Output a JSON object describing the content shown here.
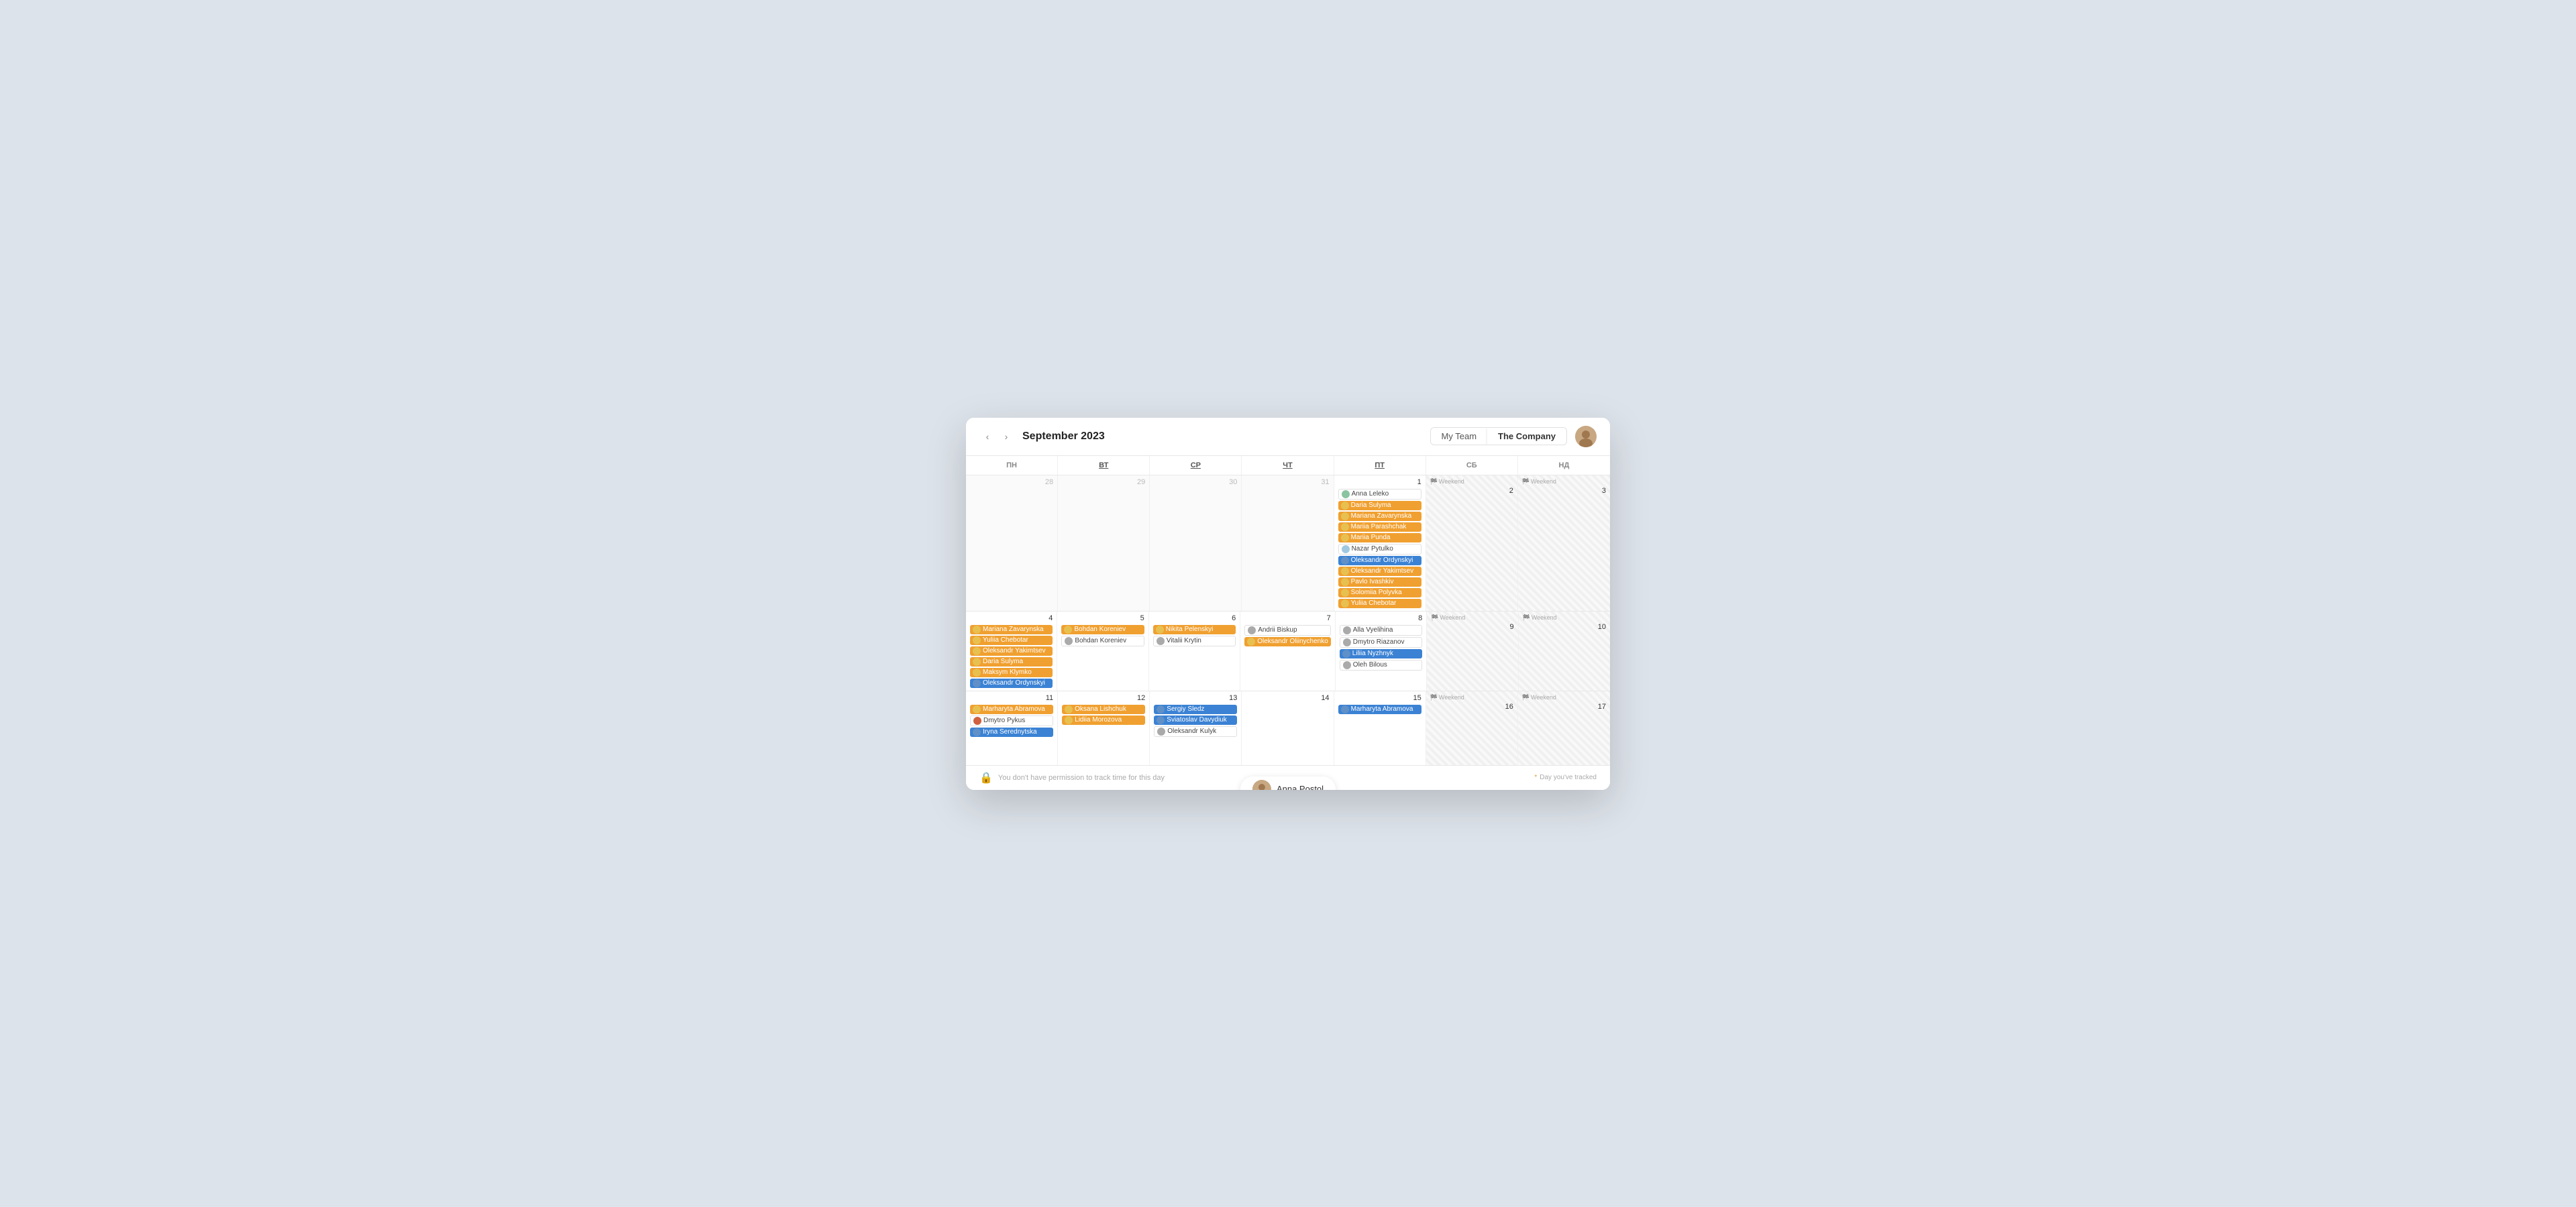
{
  "header": {
    "month_title": "September 2023",
    "nav_prev": "‹",
    "nav_next": "›",
    "tab_my_team": "My Team",
    "tab_the_company": "The Company"
  },
  "day_headers": [
    {
      "label": "пн",
      "underline": false
    },
    {
      "label": "вт",
      "underline": true
    },
    {
      "label": "ср",
      "underline": true
    },
    {
      "label": "чт",
      "underline": true
    },
    {
      "label": "пт",
      "underline": true
    },
    {
      "label": "сб",
      "underline": false
    },
    {
      "label": "нд",
      "underline": false
    }
  ],
  "weeks": [
    {
      "days": [
        {
          "num": "28",
          "outside": true,
          "events": []
        },
        {
          "num": "29",
          "outside": true,
          "events": []
        },
        {
          "num": "30",
          "outside": true,
          "events": []
        },
        {
          "num": "31",
          "outside": true,
          "events": []
        },
        {
          "num": "1",
          "outside": false,
          "events": [
            {
              "text": "Anna Leleko",
              "type": "white"
            },
            {
              "text": "Daria Sulyma",
              "type": "orange"
            },
            {
              "text": "Mariana Zavarynska",
              "type": "orange"
            },
            {
              "text": "Mariia Parashchak",
              "type": "orange"
            },
            {
              "text": "Mariia Punda",
              "type": "orange"
            },
            {
              "text": "Nazar Pytulko",
              "type": "white"
            },
            {
              "text": "Oleksandr Ordynskyi",
              "type": "blue"
            },
            {
              "text": "Oleksandr Yakimtsev",
              "type": "orange"
            },
            {
              "text": "Pavlo Ivashkiv",
              "type": "orange"
            },
            {
              "text": "Solomiia Polyvka",
              "type": "orange"
            },
            {
              "text": "Yuliia Chebotar",
              "type": "orange"
            }
          ]
        },
        {
          "num": "2",
          "outside": false,
          "weekend": true,
          "weekend_label": "Weekend",
          "events": []
        },
        {
          "num": "3",
          "outside": false,
          "weekend": true,
          "weekend_label": "Weekend",
          "events": []
        }
      ]
    },
    {
      "days": [
        {
          "num": "4",
          "outside": false,
          "events": [
            {
              "text": "Mariana Zavarynska",
              "type": "orange"
            },
            {
              "text": "Yuliia Chebotar",
              "type": "orange"
            },
            {
              "text": "Oleksandr Yakimtsev",
              "type": "orange"
            },
            {
              "text": "Daria Sulyma",
              "type": "orange"
            },
            {
              "text": "Maksym Klymko",
              "type": "orange"
            },
            {
              "text": "Oleksandr Ordynskyi",
              "type": "blue"
            }
          ]
        },
        {
          "num": "5",
          "outside": false,
          "events": [
            {
              "text": "Bohdan Koreniev",
              "type": "orange"
            },
            {
              "text": "Bohdan Koreniev",
              "type": "white"
            }
          ]
        },
        {
          "num": "6",
          "outside": false,
          "events": [
            {
              "text": "Nikita Pelenskyi",
              "type": "orange"
            },
            {
              "text": "Vitalii Krytin",
              "type": "white"
            }
          ]
        },
        {
          "num": "7",
          "outside": false,
          "events": [
            {
              "text": "Andrii Biskup",
              "type": "white"
            },
            {
              "text": "Oleksandr Oliinychenko",
              "type": "orange"
            }
          ]
        },
        {
          "num": "8",
          "outside": false,
          "events": [
            {
              "text": "Alla Vyelihina",
              "type": "white"
            },
            {
              "text": "Dmytro Riazanov",
              "type": "white"
            },
            {
              "text": "Liliia Nyzhnyk",
              "type": "blue"
            },
            {
              "text": "Oleh Bilous",
              "type": "white"
            }
          ]
        },
        {
          "num": "9",
          "outside": false,
          "weekend": true,
          "weekend_label": "Weekend",
          "events": []
        },
        {
          "num": "10",
          "outside": false,
          "weekend": true,
          "weekend_label": "Weekend",
          "events": []
        }
      ]
    },
    {
      "days": [
        {
          "num": "11",
          "outside": false,
          "events": [
            {
              "text": "Marharyta Abramova",
              "type": "orange"
            },
            {
              "text": "Dmytro Pykus",
              "type": "white"
            },
            {
              "text": "Iryna Serednytska",
              "type": "blue"
            }
          ]
        },
        {
          "num": "12",
          "outside": false,
          "events": [
            {
              "text": "Oksana Lishchuk",
              "type": "orange"
            },
            {
              "text": "Lidiia Morozova",
              "type": "orange"
            }
          ]
        },
        {
          "num": "13",
          "outside": false,
          "events": [
            {
              "text": "Sergiy Sledz",
              "type": "blue"
            },
            {
              "text": "Sviatoslav Davydiuk",
              "type": "blue"
            },
            {
              "text": "Oleksandr Kulyk",
              "type": "white"
            }
          ]
        },
        {
          "num": "14",
          "outside": false,
          "events": []
        },
        {
          "num": "15",
          "outside": false,
          "events": [
            {
              "text": "Marharyta Abramova",
              "type": "blue"
            }
          ]
        },
        {
          "num": "16",
          "outside": false,
          "weekend": true,
          "weekend_label": "Weekend",
          "events": []
        },
        {
          "num": "17",
          "outside": false,
          "weekend": true,
          "weekend_label": "Weekend",
          "events": []
        }
      ]
    }
  ],
  "footer": {
    "permission_text": "You don't have permission to track time for this day",
    "tracked_text": "Day you've tracked"
  },
  "user_bar": {
    "name": "Anna Postol"
  },
  "colors": {
    "orange": "#f0a030",
    "blue": "#3b82d4",
    "accent": "#4a90d9"
  }
}
